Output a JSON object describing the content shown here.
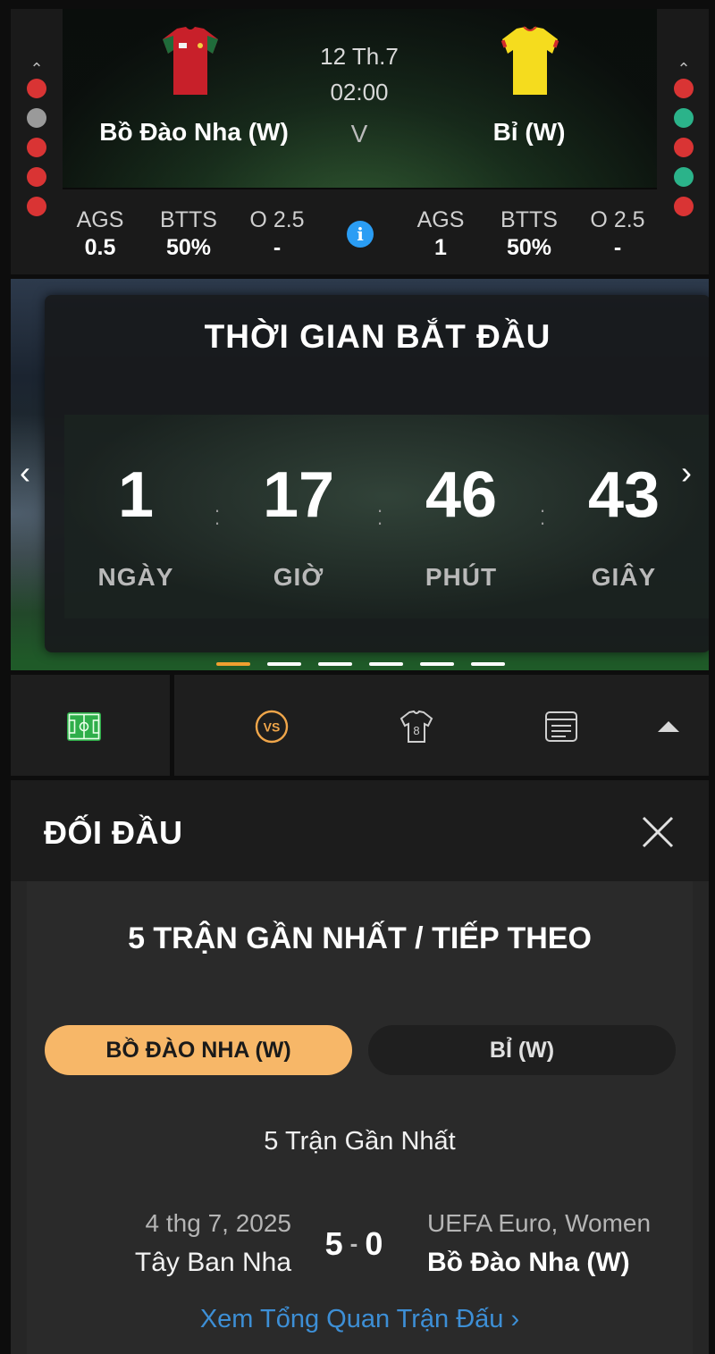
{
  "match": {
    "date": "12 Th.7",
    "time": "02:00",
    "separator": "V",
    "home_team": "Bồ Đào Nha (W)",
    "away_team": "Bỉ (W)",
    "home_form": [
      "L",
      "D",
      "L",
      "L",
      "L"
    ],
    "away_form": [
      "L",
      "W",
      "L",
      "W",
      "L"
    ],
    "home_kit_color": "#c8202a",
    "away_kit_color": "#f5dc1e",
    "form_colors": {
      "W": "#2bb38a",
      "D": "#9a9a9a",
      "L": "#d93434"
    },
    "home_stats": [
      {
        "label": "AGS",
        "value": "0.5"
      },
      {
        "label": "BTTS",
        "value": "50%"
      },
      {
        "label": "O 2.5",
        "value": "-"
      }
    ],
    "away_stats": [
      {
        "label": "AGS",
        "value": "1"
      },
      {
        "label": "BTTS",
        "value": "50%"
      },
      {
        "label": "O 2.5",
        "value": "-"
      }
    ],
    "info_icon": "i"
  },
  "countdown": {
    "title": "THỜI GIAN BẮT ĐẦU",
    "units": [
      {
        "value": "1",
        "label": "NGÀY"
      },
      {
        "value": "17",
        "label": "GIỜ"
      },
      {
        "value": "46",
        "label": "PHÚT"
      },
      {
        "value": "43",
        "label": "GIÂY"
      }
    ],
    "prev_arrow": "‹",
    "next_arrow": "›",
    "slide_count": 6,
    "active_slide": 1,
    "active_color": "#f0a030"
  },
  "tabs": [
    {
      "name": "field-icon",
      "active": true
    },
    {
      "name": "vs-icon",
      "active": false,
      "text": "VS"
    },
    {
      "name": "jersey-icon",
      "active": false,
      "text": "8"
    },
    {
      "name": "stats-table-icon",
      "active": false
    },
    {
      "name": "collapse-caret-icon",
      "active": false
    }
  ],
  "h2h": {
    "title": "ĐỐI ĐẦU",
    "section_title": "5 TRẬN GẦN NHẤT / TIẾP THEO",
    "toggle_home": "BỒ ĐÀO NHA (W)",
    "toggle_away": "BỈ (W)",
    "subhead": "5 Trận Gần Nhất",
    "matches": [
      {
        "date": "4 thg 7, 2025",
        "home": "Tây Ban Nha",
        "score_home": "5",
        "score_away": "0",
        "competition": "UEFA Euro, Women",
        "away": "Bồ Đào Nha (W)",
        "link": "Xem Tổng Quan Trận Đấu ›"
      }
    ]
  }
}
